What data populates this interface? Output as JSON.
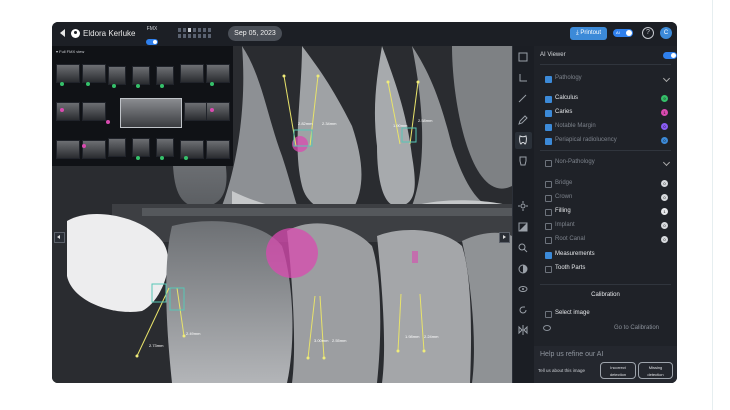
{
  "header": {
    "patient_name": "Eldora Kerluke",
    "fmx_label": "FMX",
    "date": "Sep 05, 2023",
    "printout_label": "Printout",
    "ai_toggle_label": "AI",
    "help_label": "?",
    "user_initial": "C"
  },
  "fmx_panel": {
    "label": "▾ Full FMX view"
  },
  "xray": {
    "measurements": [
      "2.82mm",
      "2.34mm",
      "1.90mm",
      "2.58mm",
      "2.73mm",
      "2.49mm",
      "3.00mm",
      "2.55mm",
      "1.98mm",
      "2.24mm"
    ]
  },
  "panel": {
    "title": "AI Viewer",
    "pathology": {
      "label": "Pathology",
      "items": [
        {
          "label": "Calculus",
          "checked": true,
          "badge": "9",
          "color": "#35c06a"
        },
        {
          "label": "Caries",
          "checked": true,
          "badge": "1",
          "color": "#d94ab0"
        },
        {
          "label": "Notable Margin",
          "checked": false,
          "badge": "0",
          "color": "#8a5cf5"
        },
        {
          "label": "Periapical radiolucency",
          "checked": false,
          "badge": "0",
          "color": "#3c8ad8"
        }
      ]
    },
    "non_pathology": {
      "label": "Non-Pathology",
      "items": [
        {
          "label": "Bridge",
          "badge": "0"
        },
        {
          "label": "Crown",
          "badge": "0"
        },
        {
          "label": "Filling",
          "badge": "1"
        },
        {
          "label": "Implant",
          "badge": "0"
        },
        {
          "label": "Root Canal",
          "badge": "0"
        }
      ]
    },
    "measurements_label": "Measurements",
    "tooth_parts_label": "Tooth Parts",
    "calibration": {
      "title": "Calibration",
      "select_image_label": "Select image",
      "go_label": "Go to Calibration"
    },
    "feedback": {
      "title": "Help us refine our AI",
      "prompt": "Tell us about this image",
      "incorrect_label": [
        "Incorrect",
        "detection"
      ],
      "missing_label": [
        "Missing",
        "detection"
      ]
    }
  },
  "colors": {
    "accent": "#3c8ad8",
    "caries": "#d94ab0",
    "calculus": "#35c06a"
  }
}
